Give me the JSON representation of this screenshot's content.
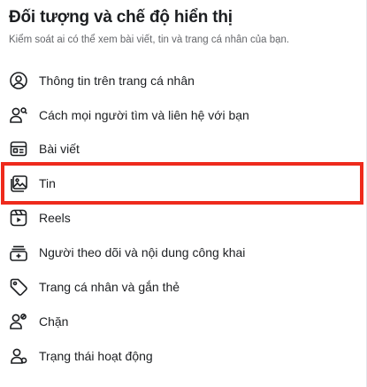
{
  "section": {
    "title": "Đối tượng và chế độ hiển thị",
    "description": "Kiểm soát ai có thể xem bài viết, tin và trang cá nhân của bạn."
  },
  "menu": {
    "items": [
      {
        "label": "Thông tin trên trang cá nhân",
        "icon": "user-circle-icon"
      },
      {
        "label": "Cách mọi người tìm và liên hệ với bạn",
        "icon": "person-search-icon"
      },
      {
        "label": "Bài viết",
        "icon": "post-icon"
      },
      {
        "label": "Tin",
        "icon": "stories-icon"
      },
      {
        "label": "Reels",
        "icon": "reels-icon"
      },
      {
        "label": "Người theo dõi và nội dung công khai",
        "icon": "followers-icon"
      },
      {
        "label": "Trang cá nhân và gắn thẻ",
        "icon": "tag-icon"
      },
      {
        "label": "Chặn",
        "icon": "block-user-icon"
      },
      {
        "label": "Trạng thái hoạt động",
        "icon": "active-status-icon"
      }
    ]
  },
  "highlight": {
    "target": "Tin",
    "color": "#ee2a1c"
  }
}
